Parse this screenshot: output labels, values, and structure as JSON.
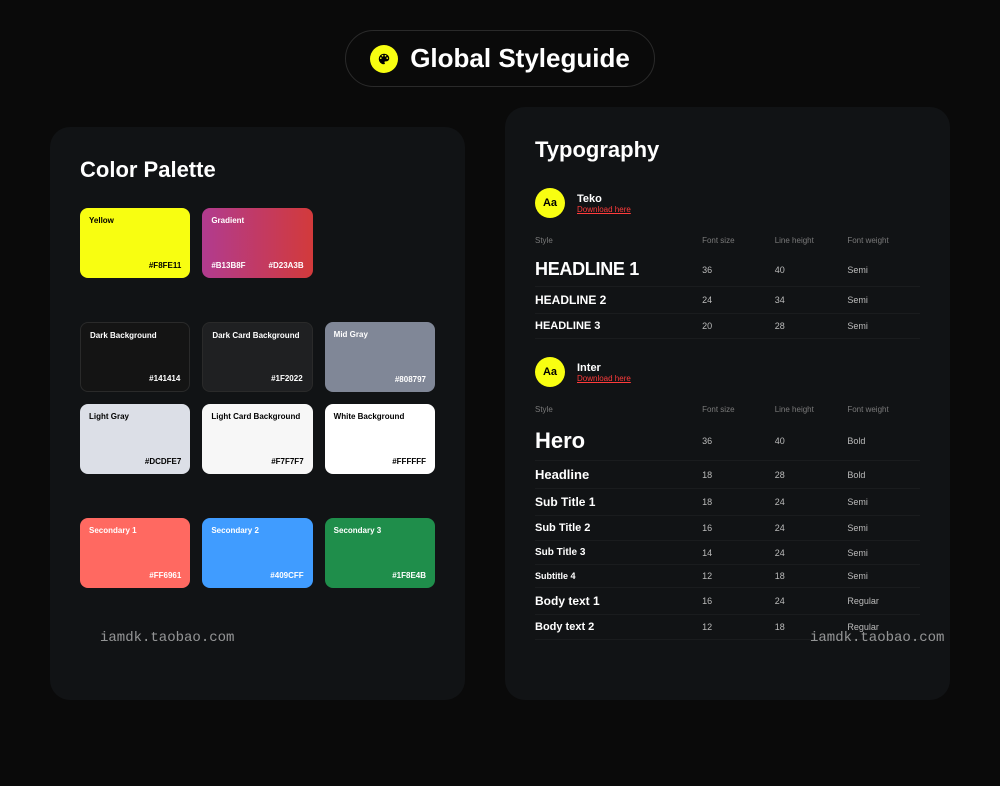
{
  "header": {
    "title": "Global Styleguide"
  },
  "palette": {
    "title": "Color Palette",
    "swatches": [
      {
        "label": "Yellow",
        "hex": "#F8FE11",
        "bg": "#F8FE11",
        "text": "dark"
      },
      {
        "label": "Gradient",
        "hex": "#B13B8F",
        "hex2": "#D23A3B",
        "bg": "linear-gradient(90deg,#B13B8F,#D23A3B)",
        "text": "light"
      }
    ],
    "darks": [
      {
        "label": "Dark Background",
        "hex": "#141414",
        "bg": "#141414",
        "text": "light"
      },
      {
        "label": "Dark Card Background",
        "hex": "#1F2022",
        "bg": "#1F2022",
        "text": "light"
      },
      {
        "label": "Mid Gray",
        "hex": "#808797",
        "bg": "#808797",
        "text": "light"
      },
      {
        "label": "Light Gray",
        "hex": "#DCDFE7",
        "bg": "#DCDFE7",
        "text": "dark"
      },
      {
        "label": "Light Card Background",
        "hex": "#F7F7F7",
        "bg": "#F7F7F7",
        "text": "dark"
      },
      {
        "label": "White Background",
        "hex": "#FFFFFF",
        "bg": "#FFFFFF",
        "text": "dark"
      }
    ],
    "secondary": [
      {
        "label": "Secondary 1",
        "hex": "#FF6961",
        "bg": "#FF6961",
        "text": "light"
      },
      {
        "label": "Secondary 2",
        "hex": "#409CFF",
        "bg": "#409CFF",
        "text": "light"
      },
      {
        "label": "Secondary 3",
        "hex": "#1F8E4B",
        "bg": "#1F8E4B",
        "text": "light"
      }
    ]
  },
  "typography": {
    "title": "Typography",
    "fonts": [
      {
        "badge": "Aa",
        "name": "Teko",
        "download": "Download here",
        "headers": [
          "Style",
          "Font size",
          "Line height",
          "Font weight"
        ],
        "rows": [
          {
            "style": "HEADLINE 1",
            "cls": "hl1",
            "size": "36",
            "lh": "40",
            "weight": "Semi"
          },
          {
            "style": "HEADLINE 2",
            "cls": "hl2",
            "size": "24",
            "lh": "34",
            "weight": "Semi"
          },
          {
            "style": "HEADLINE 3",
            "cls": "hl3",
            "size": "20",
            "lh": "28",
            "weight": "Semi"
          }
        ]
      },
      {
        "badge": "Aa",
        "name": "Inter",
        "download": "Download here",
        "headers": [
          "Style",
          "Font size",
          "Line height",
          "Font weight"
        ],
        "rows": [
          {
            "style": "Hero",
            "cls": "hero",
            "size": "36",
            "lh": "40",
            "weight": "Bold"
          },
          {
            "style": "Headline",
            "cls": "headline-body",
            "size": "18",
            "lh": "28",
            "weight": "Bold"
          },
          {
            "style": "Sub Title 1",
            "cls": "sub1",
            "size": "18",
            "lh": "24",
            "weight": "Semi"
          },
          {
            "style": "Sub Title 2",
            "cls": "sub2",
            "size": "16",
            "lh": "24",
            "weight": "Semi"
          },
          {
            "style": "Sub Title 3",
            "cls": "sub3",
            "size": "14",
            "lh": "24",
            "weight": "Semi"
          },
          {
            "style": "Subtitle 4",
            "cls": "sub4",
            "size": "12",
            "lh": "18",
            "weight": "Semi"
          },
          {
            "style": "Body text 1",
            "cls": "body1",
            "size": "16",
            "lh": "24",
            "weight": "Regular"
          },
          {
            "style": "Body text 2",
            "cls": "body2",
            "size": "12",
            "lh": "18",
            "weight": "Regular"
          }
        ]
      }
    ]
  },
  "watermarks": [
    "iamdk.taobao.com",
    "iamdk.taobao.com"
  ]
}
